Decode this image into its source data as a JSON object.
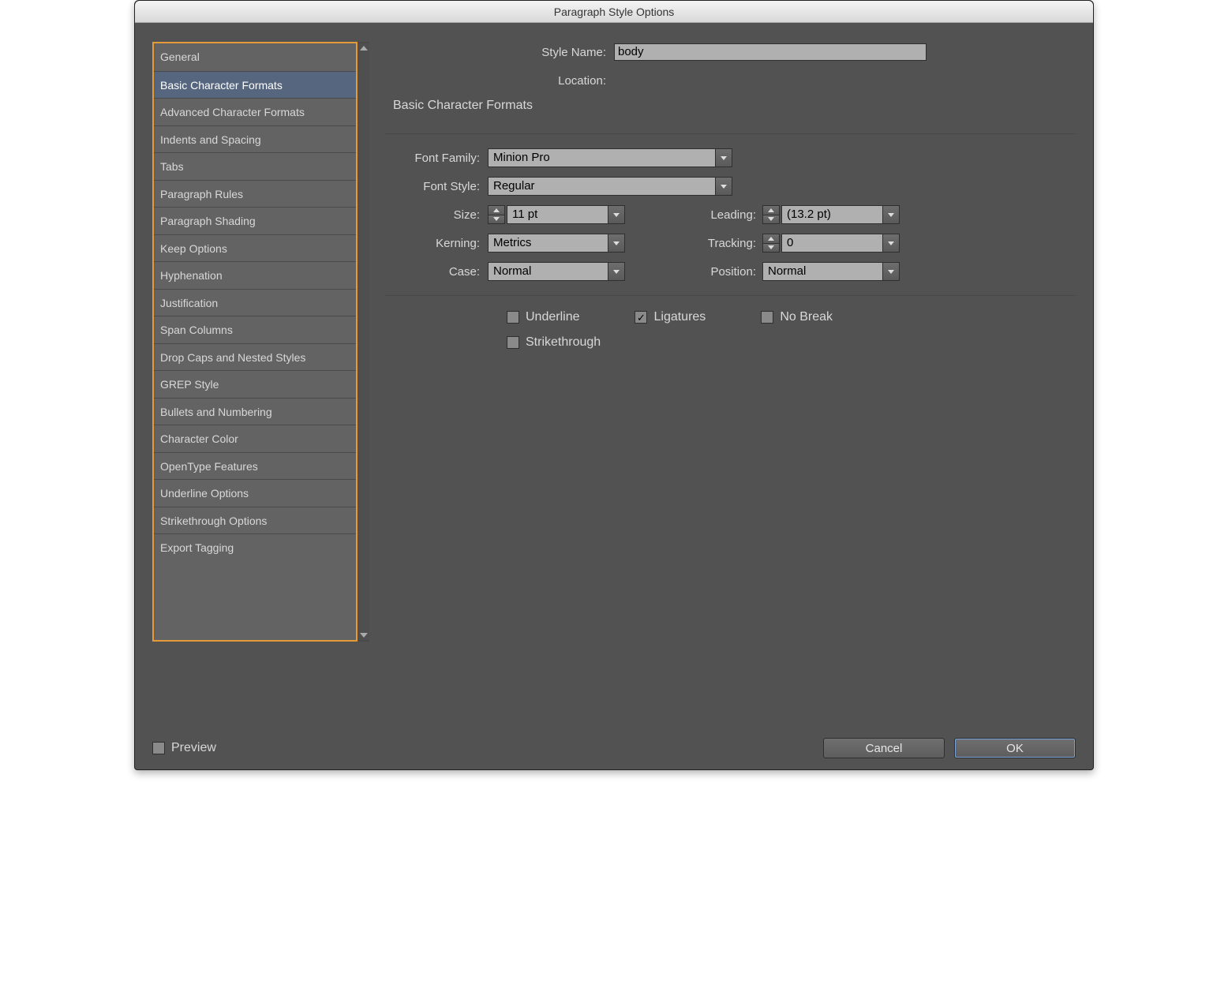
{
  "window": {
    "title": "Paragraph Style Options"
  },
  "sidebar": {
    "items": [
      "General",
      "Basic Character Formats",
      "Advanced Character Formats",
      "Indents and Spacing",
      "Tabs",
      "Paragraph Rules",
      "Paragraph Shading",
      "Keep Options",
      "Hyphenation",
      "Justification",
      "Span Columns",
      "Drop Caps and Nested Styles",
      "GREP Style",
      "Bullets and Numbering",
      "Character Color",
      "OpenType Features",
      "Underline Options",
      "Strikethrough Options",
      "Export Tagging"
    ],
    "selected_index": 1
  },
  "header": {
    "style_name_label": "Style Name:",
    "style_name_value": "body",
    "location_label": "Location:",
    "section_title": "Basic Character Formats"
  },
  "fields": {
    "font_family": {
      "label": "Font Family:",
      "value": "Minion Pro"
    },
    "font_style": {
      "label": "Font Style:",
      "value": "Regular"
    },
    "size": {
      "label": "Size:",
      "value": "11 pt"
    },
    "leading": {
      "label": "Leading:",
      "value": "(13.2 pt)"
    },
    "kerning": {
      "label": "Kerning:",
      "value": "Metrics"
    },
    "tracking": {
      "label": "Tracking:",
      "value": "0"
    },
    "case": {
      "label": "Case:",
      "value": "Normal"
    },
    "position": {
      "label": "Position:",
      "value": "Normal"
    }
  },
  "checkboxes": {
    "underline": {
      "label": "Underline",
      "checked": false
    },
    "ligatures": {
      "label": "Ligatures",
      "checked": true
    },
    "no_break": {
      "label": "No Break",
      "checked": false
    },
    "strikethrough": {
      "label": "Strikethrough",
      "checked": false
    }
  },
  "footer": {
    "preview_label": "Preview",
    "preview_checked": false,
    "cancel_label": "Cancel",
    "ok_label": "OK"
  }
}
